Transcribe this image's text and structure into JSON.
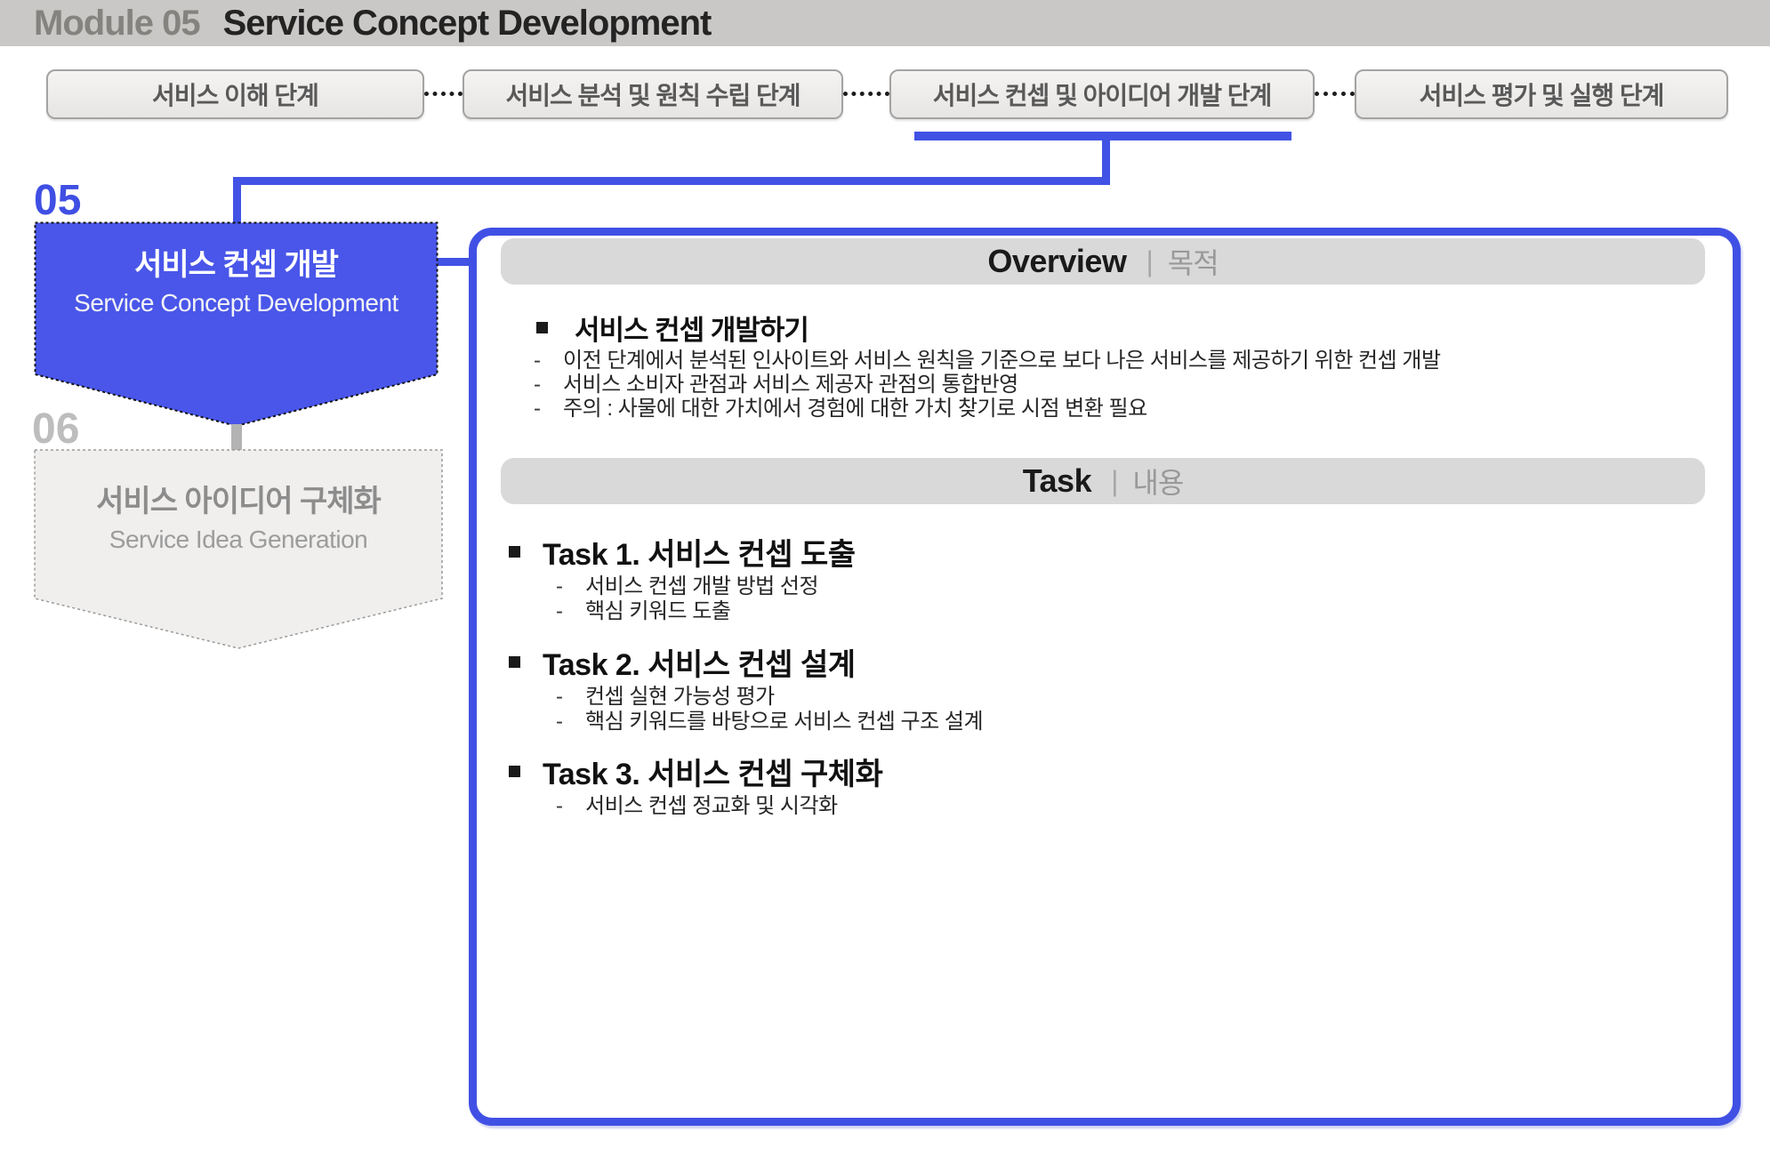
{
  "header": {
    "module": "Module 05",
    "title": "Service Concept Development"
  },
  "stage_tabs": [
    {
      "label": "서비스 이해 단계",
      "active": false
    },
    {
      "label": "서비스 분석 및 원칙 수립 단계",
      "active": false
    },
    {
      "label": "서비스 컨셉 및 아이디어 개발 단계",
      "active": true
    },
    {
      "label": "서비스 평가 및 실행 단계",
      "active": false
    }
  ],
  "module_nodes": {
    "current": {
      "number": "05",
      "title_ko": "서비스 컨셉 개발",
      "title_en": "Service Concept Development"
    },
    "next": {
      "number": "06",
      "title_ko": "서비스 아이디어 구체화",
      "title_en": "Service Idea Generation"
    }
  },
  "markers": {
    "square": "▪",
    "dash": "-"
  },
  "panel": {
    "overview": {
      "heading": "Overview",
      "divider": "|",
      "subheading": "목적",
      "bullet_title": "서비스 컨셉 개발하기",
      "items": [
        "이전 단계에서 분석된 인사이트와 서비스 원칙을 기준으로 보다 나은 서비스를 제공하기 위한 컨셉 개발",
        "서비스 소비자 관점과 서비스 제공자 관점의 통합반영",
        "주의 : 사물에 대한 가치에서 경험에 대한 가치 찾기로 시점 변환 필요"
      ]
    },
    "task": {
      "heading": "Task",
      "divider": "|",
      "subheading": "내용",
      "tasks": [
        {
          "title": "Task 1. 서비스 컨셉 도출",
          "items": [
            "서비스 컨셉 개발 방법 선정",
            "핵심 키워드 도출"
          ]
        },
        {
          "title": "Task 2. 서비스 컨셉 설계",
          "items": [
            "컨셉 실현 가능성 평가",
            "핵심 키워드를 바탕으로 서비스 컨셉 구조 설계"
          ]
        },
        {
          "title": "Task 3. 서비스 컨셉 구체화",
          "items": [
            "서비스 컨셉 정교화 및 시각화"
          ]
        }
      ]
    }
  },
  "colors": {
    "accent_blue": "#4152e5",
    "banner_fill": "#4956e9",
    "banner_stroke": "#111111",
    "next_fill": "#f0efee",
    "next_stroke": "#9a9a9a",
    "bar_gray": "#d9d9d9",
    "header_gray": "#cac8c6"
  }
}
